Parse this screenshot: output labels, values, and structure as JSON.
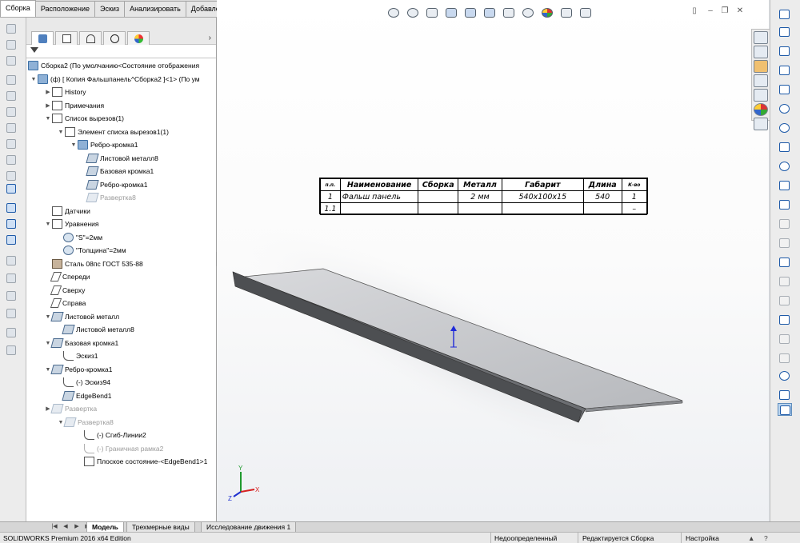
{
  "top_tabs": [
    "Сборка",
    "Расположение",
    "Эскиз",
    "Анализировать",
    "Добавления SOLIDWORKS"
  ],
  "tree": {
    "root_label": "Сборка2  (По умолчанию<Состояние отображения",
    "component_label": "(ф) [ Копия Фальшпанель^Сборка2 ]<1> (По ум",
    "items": [
      {
        "label": "History",
        "icon": "history-icon"
      },
      {
        "label": "Примечания",
        "icon": "annotations-icon"
      },
      {
        "label": "Список вырезов(1)",
        "icon": "cutlist-icon"
      },
      {
        "label": "Элемент списка вырезов1(1)",
        "icon": "cutlist-item-icon"
      },
      {
        "label": "Ребро-кромка1",
        "icon": "edge-flange-icon"
      },
      {
        "label": "Листовой металл8",
        "icon": "sheet-metal-icon"
      },
      {
        "label": "Базовая кромка1",
        "icon": "base-flange-icon"
      },
      {
        "label": "Ребро-кромка1",
        "icon": "edge-flange-icon"
      },
      {
        "label": "Развертка8",
        "icon": "flat-pattern-icon"
      },
      {
        "label": "Датчики",
        "icon": "sensors-icon"
      },
      {
        "label": "Уравнения",
        "icon": "equations-icon"
      },
      {
        "label": "\"S\"=2мм",
        "icon": "global-variable-icon"
      },
      {
        "label": "\"Толщина\"=2мм",
        "icon": "global-variable-icon"
      },
      {
        "label": "Сталь 08пс ГОСТ 535-88",
        "icon": "material-icon"
      },
      {
        "label": "Спереди",
        "icon": "plane-icon"
      },
      {
        "label": "Сверху",
        "icon": "plane-icon"
      },
      {
        "label": "Справа",
        "icon": "plane-icon"
      },
      {
        "label": "Листовой металл",
        "icon": "sheet-metal-icon"
      },
      {
        "label": "Листовой металл8",
        "icon": "sheet-metal-icon"
      },
      {
        "label": "Базовая кромка1",
        "icon": "base-flange-icon"
      },
      {
        "label": "Эскиз1",
        "icon": "sketch-icon"
      },
      {
        "label": "Ребро-кромка1",
        "icon": "edge-flange-icon"
      },
      {
        "label": "(-) Эскиз94",
        "icon": "sketch-icon"
      },
      {
        "label": "EdgeBend1",
        "icon": "edge-bend-icon"
      },
      {
        "label": "Развертка",
        "icon": "flat-pattern-icon"
      },
      {
        "label": "Развертка8",
        "icon": "flat-pattern-icon"
      },
      {
        "label": "(-) Сгиб-Линии2",
        "icon": "sketch-icon"
      },
      {
        "label": "(-) Граничная рамка2",
        "icon": "sketch-icon"
      },
      {
        "label": "Плоское состояние-<EdgeBend1>1",
        "icon": "flat-state-icon"
      }
    ]
  },
  "bom": {
    "headers": [
      "п.п.",
      "Наименование",
      "Сборка",
      "Металл",
      "Габарит",
      "Длина",
      "К-во"
    ],
    "rows": [
      [
        "1",
        "Фальш панель",
        "",
        "2 мм",
        "540x100x15",
        "540",
        "1"
      ],
      [
        "1.1",
        "",
        "",
        "",
        "",
        "",
        "–"
      ]
    ]
  },
  "triad": {
    "x": "X",
    "y": "Y",
    "z": "Z"
  },
  "bottom_tabs": [
    "Модель",
    "Трехмерные виды",
    "Исследование движения 1"
  ],
  "status": {
    "edition": "SOLIDWORKS Premium 2016 x64 Edition",
    "state": "Недоопределенный",
    "editing": "Редактируется Сборка",
    "settings": "Настройка"
  }
}
